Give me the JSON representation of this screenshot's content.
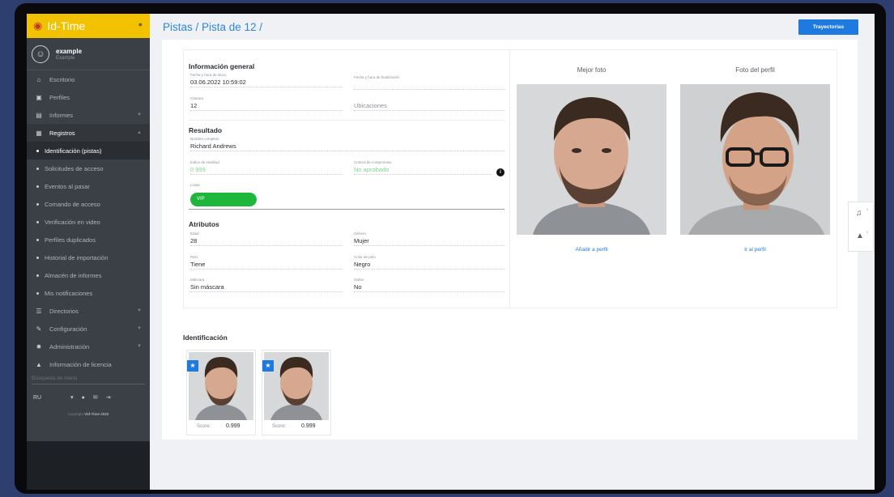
{
  "app": {
    "name": "Id-Time"
  },
  "user": {
    "name": "example",
    "role": "Example"
  },
  "sidebar": {
    "items": [
      {
        "label": "Escritorio",
        "icon": "home-icon"
      },
      {
        "label": "Perfiles",
        "icon": "id-card-icon"
      },
      {
        "label": "Informes",
        "icon": "report-icon"
      },
      {
        "label": "Registros",
        "icon": "table-icon"
      }
    ],
    "subitems": [
      "Identificación (pistas)",
      "Solicitudes de acceso",
      "Eventos al pasar",
      "Comando de acceso",
      "Verificación en video",
      "Perfiles duplicados",
      "Historial de importación",
      "Almacén de informes",
      "Mis notificaciones"
    ],
    "bottom_items": [
      {
        "label": "Directorios",
        "icon": "list-icon"
      },
      {
        "label": "Configuración",
        "icon": "wrench-icon"
      },
      {
        "label": "Administración",
        "icon": "gear-icon"
      },
      {
        "label": "Información de licencia",
        "icon": "license-icon"
      }
    ],
    "search_placeholder": "Búsqueda de menú",
    "language": "RU",
    "copyright_prefix": "Copyright",
    "copyright_brand": "Vid-Time 2022"
  },
  "header": {
    "breadcrumb": "Pistas / Pista de 12 /",
    "action_label": "Trayectorias"
  },
  "general": {
    "title": "Información general",
    "start_label": "Fecha y hora de inicio",
    "start_value": "03.06.2022 10:59:02",
    "end_label": "Fecha y hora de finalización",
    "end_value": "",
    "camera_label": "Cámara",
    "camera_value": "12",
    "locations_value": "Ubicaciones"
  },
  "result": {
    "title": "Resultado",
    "name_label": "Nombre completo",
    "name_value": "Richard Andrews",
    "similarity_label": "Índice de similitud",
    "similarity_value": "0.999",
    "check_label": "Control de compromiso",
    "check_value": "No aprobado",
    "lists_label": "Listas",
    "list_badge": "VIP",
    "list_badge_color": "#1fb63c"
  },
  "attributes": {
    "title": "Atributos",
    "age_label": "Edad",
    "age_value": "28",
    "gender_label": "Género",
    "gender_value": "Mujer",
    "hair_label": "Pelo",
    "hair_value": "Tiene",
    "hair_color_label": "Color de pelo",
    "hair_color_value": "Negro",
    "mask_label": "Máscara",
    "mask_value": "Sin máscara",
    "glasses_label": "Gafas",
    "glasses_value": "No"
  },
  "photos": {
    "best_title": "Mejor foto",
    "profile_title": "Foto del perfil",
    "add_link": "Añadir a perfil",
    "goto_link": "Ir al perfil"
  },
  "identification": {
    "title": "Identificación",
    "score_label": "Score:",
    "tiles": [
      {
        "score": "0.999"
      },
      {
        "score": "0.999"
      }
    ]
  },
  "colors": {
    "accent": "#1f7ae0",
    "brand": "#f2c200",
    "sidebar": "#3b4046"
  },
  "floating": {
    "bell_count": "0",
    "alert_count": "0"
  }
}
